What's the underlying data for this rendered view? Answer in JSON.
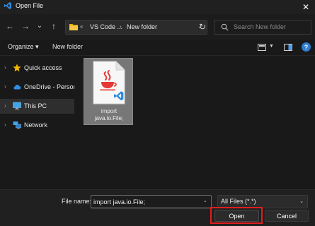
{
  "window": {
    "title": "Open File",
    "app_icon": "vscode-icon",
    "close_glyph": "✕"
  },
  "navigation": {
    "back_glyph": "←",
    "forward_glyph": "→",
    "recent_glyph": "⌄",
    "up_glyph": "↑"
  },
  "address": {
    "segments": [
      "VS Code ...",
      "New folder"
    ],
    "separator": "›",
    "overflow": "«"
  },
  "search": {
    "placeholder": "Search New folder"
  },
  "toolbar": {
    "organize_label": "Organize ▾",
    "new_folder_label": "New folder",
    "help_glyph": "?"
  },
  "sidebar": {
    "items": [
      {
        "label": "Quick access",
        "icon": "star-icon",
        "selected": false
      },
      {
        "label": "OneDrive - Personal",
        "icon": "cloud-icon",
        "selected": false
      },
      {
        "label": "This PC",
        "icon": "monitor-icon",
        "selected": true
      },
      {
        "label": "Network",
        "icon": "network-icon",
        "selected": false
      }
    ]
  },
  "files": [
    {
      "name_line1": "import",
      "name_line2": "java.io.File;",
      "icon": "java-file-icon",
      "selected": true
    }
  ],
  "footer": {
    "file_name_label": "File name:",
    "file_name_value": "import java.io.File;",
    "file_type": "All Files (*.*)",
    "open_label": "Open",
    "cancel_label": "Cancel"
  },
  "colors": {
    "background": "#191919",
    "highlight_outline": "#e01e1e",
    "accent_blue": "#2d7dd2",
    "star": "#f2b900",
    "java_red": "#e53935"
  }
}
